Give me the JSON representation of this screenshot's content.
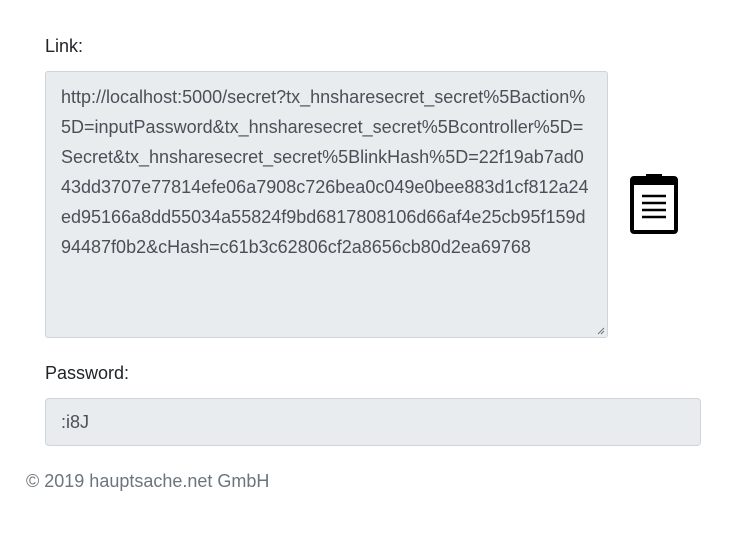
{
  "form": {
    "link_label": "Link:",
    "link_value": "http://localhost:5000/secret?tx_hnsharesecret_secret%5Baction%5D=inputPassword&tx_hnsharesecret_secret%5Bcontroller%5D=Secret&tx_hnsharesecret_secret%5BlinkHash%5D=22f19ab7ad043dd3707e77814efe06a7908c726bea0c049e0bee883d1cf812a24ed95166a8dd55034a55824f9bd6817808106d66af4e25cb95f159d94487f0b2&cHash=c61b3c62806cf2a8656cb80d2ea69768",
    "copy_icon": "clipboard-icon",
    "password_label": "Password:",
    "password_value": ":i8J"
  },
  "footer": {
    "copyright": "© 2019 hauptsache.net GmbH"
  }
}
